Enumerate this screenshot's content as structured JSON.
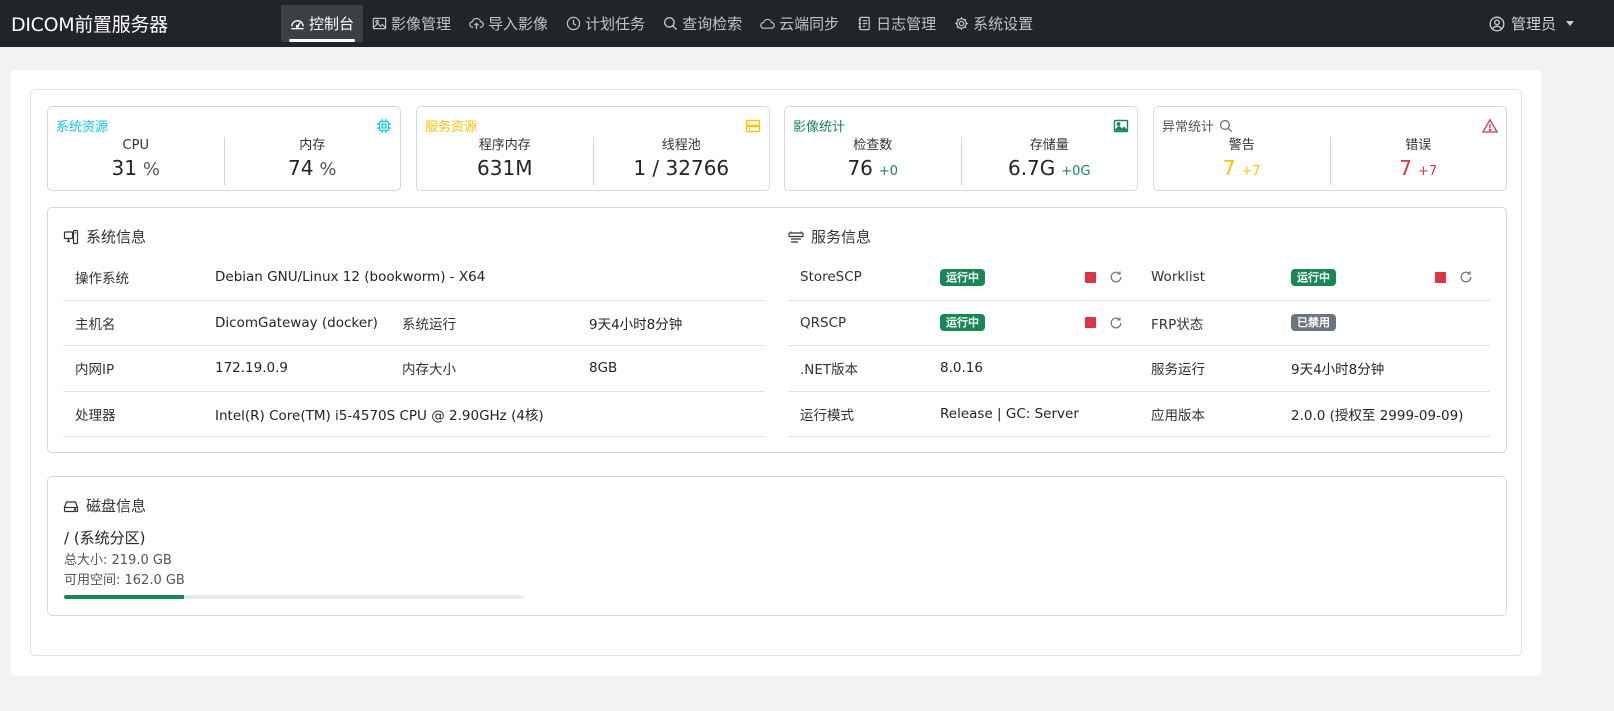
{
  "app": {
    "title": "DICOM前置服务器"
  },
  "nav": {
    "items": [
      {
        "label": "控制台",
        "icon": "dashboard-icon",
        "active": true
      },
      {
        "label": "影像管理",
        "icon": "image-icon"
      },
      {
        "label": "导入影像",
        "icon": "cloud-upload-icon"
      },
      {
        "label": "计划任务",
        "icon": "clock-icon"
      },
      {
        "label": "查询检索",
        "icon": "search-icon"
      },
      {
        "label": "云端同步",
        "icon": "cloud-icon"
      },
      {
        "label": "日志管理",
        "icon": "journal-icon"
      },
      {
        "label": "系统设置",
        "icon": "gear-icon"
      }
    ],
    "user": {
      "label": "管理员",
      "icon": "user-circle-icon"
    }
  },
  "stats": {
    "system": {
      "title": "系统资源",
      "color": "#0dcaf0",
      "icon": "cpu-icon",
      "cpu_label": "CPU",
      "cpu_value": "31",
      "cpu_unit": "%",
      "mem_label": "内存",
      "mem_value": "74",
      "mem_unit": "%"
    },
    "service": {
      "title": "服务资源",
      "color": "#ffc107",
      "icon": "server-icon",
      "mem_label": "程序内存",
      "mem_value": "631M",
      "pool_label": "线程池",
      "pool_value": "1 / 32766"
    },
    "image": {
      "title": "影像统计",
      "color": "#198754",
      "icon": "image-icon",
      "count_label": "检查数",
      "count_value": "76",
      "count_delta": "+0",
      "storage_label": "存储量",
      "storage_value": "6.7G",
      "storage_delta": "+0G"
    },
    "error": {
      "title": "异常统计",
      "color": "#dc3545",
      "icon": "warning-triangle-icon",
      "warn_label": "警告",
      "warn_value": "7",
      "warn_delta": "+7",
      "warn_color": "#ffc107",
      "err_label": "错误",
      "err_value": "7",
      "err_delta": "+7",
      "err_color": "#dc3545"
    }
  },
  "system_info": {
    "title": "系统信息",
    "os_label": "操作系统",
    "os_value": "Debian GNU/Linux 12 (bookworm) - X64",
    "host_label": "主机名",
    "host_value": "DicomGateway (docker)",
    "uptime_label": "系统运行",
    "uptime_value": "9天4小时8分钟",
    "ip_label": "内网IP",
    "ip_value": "172.19.0.9",
    "memsize_label": "内存大小",
    "memsize_value": "8GB",
    "cpu_label": "处理器",
    "cpu_value": "Intel(R) Core(TM) i5-4570S CPU @ 2.90GHz (4核)"
  },
  "service_info": {
    "title": "服务信息",
    "storescp_label": "StoreSCP",
    "storescp_status": "运行中",
    "worklist_label": "Worklist",
    "worklist_status": "运行中",
    "qrscp_label": "QRSCP",
    "qrscp_status": "运行中",
    "frp_label": "FRP状态",
    "frp_status": "已禁用",
    "net_label": ".NET版本",
    "net_value": "8.0.16",
    "svc_uptime_label": "服务运行",
    "svc_uptime_value": "9天4小时8分钟",
    "mode_label": "运行模式",
    "mode_value": "Release | GC: Server",
    "version_label": "应用版本",
    "version_value": "2.0.0 (授权至 2999-09-09)"
  },
  "disk": {
    "title": "磁盘信息",
    "name": "/ (系统分区)",
    "total": "总大小: 219.0 GB",
    "free": "可用空间: 162.0 GB",
    "used_fraction": 0.26
  }
}
